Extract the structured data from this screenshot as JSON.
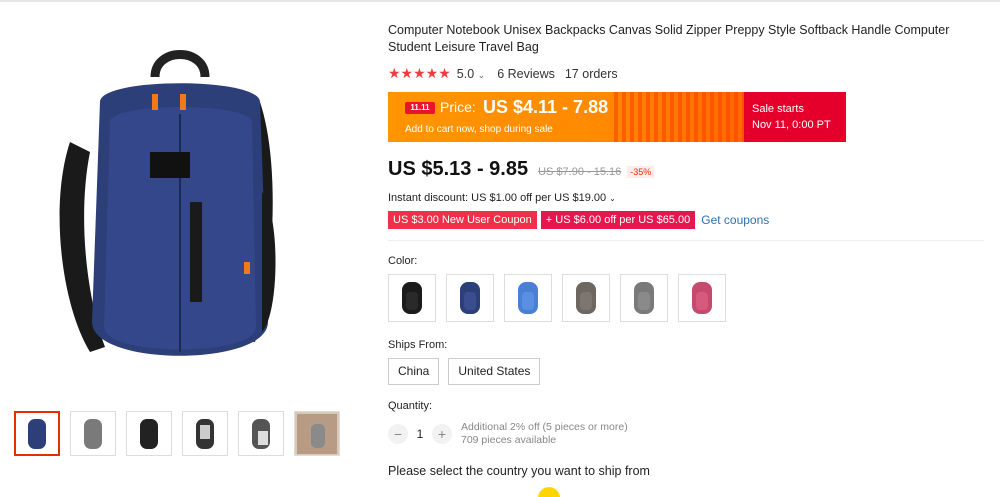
{
  "product": {
    "title": "Computer Notebook Unisex Backpacks Canvas Solid Zipper Preppy Style Softback Handle Computer Student Leisure Travel Bag",
    "stars": "★★★★★",
    "rating": "5.0",
    "reviews": "6 Reviews",
    "orders": "17 orders"
  },
  "promo": {
    "tag": "11.11",
    "label": "Price:",
    "price": "US $4.11 - 7.88",
    "sub": "Add to cart now, shop during sale",
    "sale_line1": "Sale starts",
    "sale_line2": "Nov 11, 0:00 PT"
  },
  "pricing": {
    "current": "US $5.13 - 9.85",
    "original": "US $7.90 - 15.16",
    "discount": "-35%",
    "instant": "Instant discount: US $1.00 off per US $19.00",
    "coupon1": "US $3.00 New User Coupon",
    "coupon2": "+ US $6.00 off per US $65.00",
    "get_coupons": "Get coupons"
  },
  "color": {
    "label": "Color:",
    "options": [
      "black",
      "navy",
      "blue",
      "gray-brown",
      "gray",
      "pink"
    ]
  },
  "ships": {
    "label": "Ships From:",
    "options": [
      "China",
      "United States"
    ]
  },
  "quantity": {
    "label": "Quantity:",
    "minus": "−",
    "plus": "+",
    "value": "1",
    "note1": "Additional 2% off (5 pieces or more)",
    "note2": "709 pieces available"
  },
  "country_prompt": "Please select the country you want to ship from",
  "colors": {
    "bag_navy": "#2d3f78",
    "promo_orange": "#ff8a00",
    "sale_red": "#e4002b",
    "link_blue": "#2e6fb6"
  }
}
